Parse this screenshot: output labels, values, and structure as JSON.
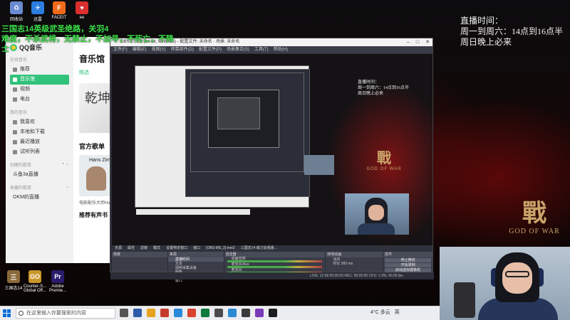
{
  "overlay": {
    "schedule_line1": "直播时间：",
    "schedule_line2": "周一到周六：14点到16点半",
    "schedule_line3": "周日晚上必来",
    "green_line1": "三国志14英级武圣绝路，关羽4",
    "green_line2": "难度，不杀武将，无禁止，不加寻，不死亡，不降士",
    "logo_glyph": "戰",
    "logo_text": "GOD OF WAR"
  },
  "desktop_icons_top": [
    {
      "label": "回收站",
      "color": "#6a8bd1",
      "glyph": "♻"
    },
    {
      "label": "迅雷",
      "color": "#2b7de0",
      "glyph": "✈"
    },
    {
      "label": "FACEIT",
      "color": "#ef6a1a",
      "glyph": "F"
    },
    {
      "label": "ee",
      "color": "#d92f2f",
      "glyph": "♥"
    }
  ],
  "desktop_icons_bottom": [
    {
      "label": "三国志14",
      "color": "#8a6a3a",
      "glyph": "三"
    },
    {
      "label": "Counter-S... Global Off...",
      "color": "#c9962b",
      "glyph": "GO"
    },
    {
      "label": "Adobe Premie...",
      "color": "#2a1c6b",
      "glyph": "Pr"
    }
  ],
  "qq_music": {
    "app_name": "QQ音乐",
    "group_online": "在线音乐",
    "nav_online": [
      {
        "label": "推荐",
        "active": false
      },
      {
        "label": "音乐馆",
        "active": true
      },
      {
        "label": "视频",
        "active": false
      },
      {
        "label": "电台",
        "active": false
      }
    ],
    "group_mine": "我的音乐",
    "nav_mine": [
      {
        "label": "我喜欢",
        "active": false
      },
      {
        "label": "本地和下载",
        "active": false
      },
      {
        "label": "最近播放",
        "active": false
      },
      {
        "label": "试听列表",
        "active": false
      }
    ],
    "group_created": "创建的歌单",
    "created_item": "斗鱼3a直播",
    "group_favorite": "收藏的歌单",
    "favorite_item": "OKM的直播",
    "page_title": "音乐馆",
    "tab_selected": "精选",
    "album_glyph": "乾坤",
    "section_playlists": "官方歌单",
    "card_artist": "Hans Zim",
    "card_caption": "电影配乐大师Ha",
    "section_recommend": "推荐有声书"
  },
  "obs": {
    "title": "OBS 27.1.3 (64-bit, windows) - 配置文件: 未命名 - 场景: 未命名",
    "menu": [
      "文件(F)",
      "编辑(E)",
      "视图(V)",
      "停靠部件(D)",
      "配置文件(P)",
      "场景集合(S)",
      "工具(T)",
      "帮助(H)"
    ],
    "source_bar": [
      "无源",
      "属性",
      "滤镜",
      "模式",
      "设置特定窗口",
      "窗口",
      "[OBS-MS_2] ene2",
      "三国志14 威力加强版..."
    ],
    "docks": {
      "scenes": "场景",
      "sources": "来源",
      "source_rows": [
        "直播时间",
        "文本",
        "视频采集设备",
        "图像",
        "文本",
        "窗口"
      ],
      "mixer": "混音器",
      "mixer_rows": [
        "桌面音频",
        "麦克风/Aux",
        "麦克风"
      ],
      "transitions": "转场动画",
      "transition_type": "淡出",
      "duration_label": "时长",
      "duration_value": "300 ms",
      "controls": "控件",
      "control_buttons": [
        "停止推流",
        "开始录制",
        "启动虚拟摄像机",
        "工作室模式",
        "设置",
        "退出"
      ]
    },
    "status": "LIVE: 12:58  00:00:00   REC: 00:00:00   CPU: 1.9%, 60.00 fps"
  },
  "taskbar": {
    "search_placeholder": "在这里输入你要搜索的内容",
    "weather": "4°C 多云",
    "language": "英",
    "app_colors": [
      "#555555",
      "#2f5ca8",
      "#e7a31f",
      "#c63b2b",
      "#2a89d8",
      "#d9432f",
      "#0e7a3c",
      "#4b4b4b",
      "#2a8ad4",
      "#3a3a3a",
      "#7a3ab8",
      "#1c1c1c"
    ]
  }
}
